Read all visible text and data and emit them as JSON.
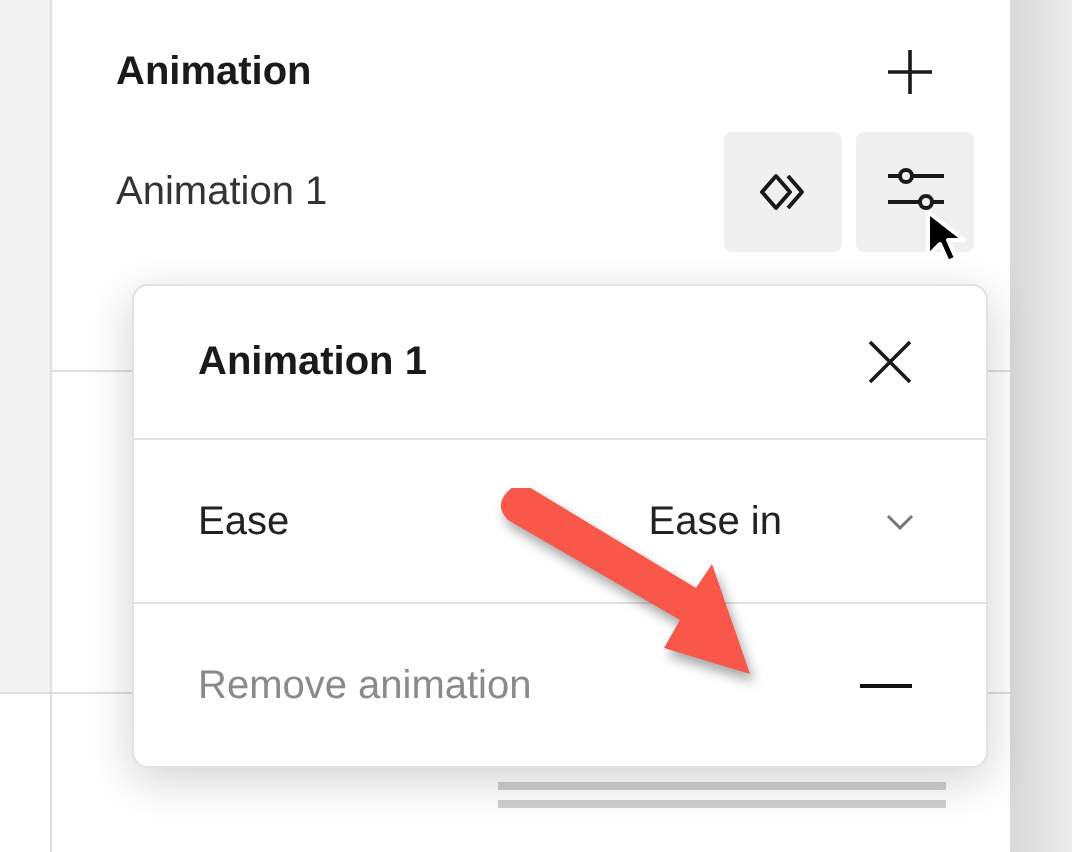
{
  "section_title": "Animation",
  "animations": [
    {
      "label": "Animation 1",
      "hovered": true
    }
  ],
  "popup": {
    "title": "Animation 1",
    "rows": [
      {
        "kind": "select",
        "label": "Ease",
        "value": "Ease in"
      },
      {
        "kind": "action",
        "label": "Remove animation",
        "disabled": true
      }
    ]
  },
  "annotation": {
    "kind": "arrow"
  }
}
